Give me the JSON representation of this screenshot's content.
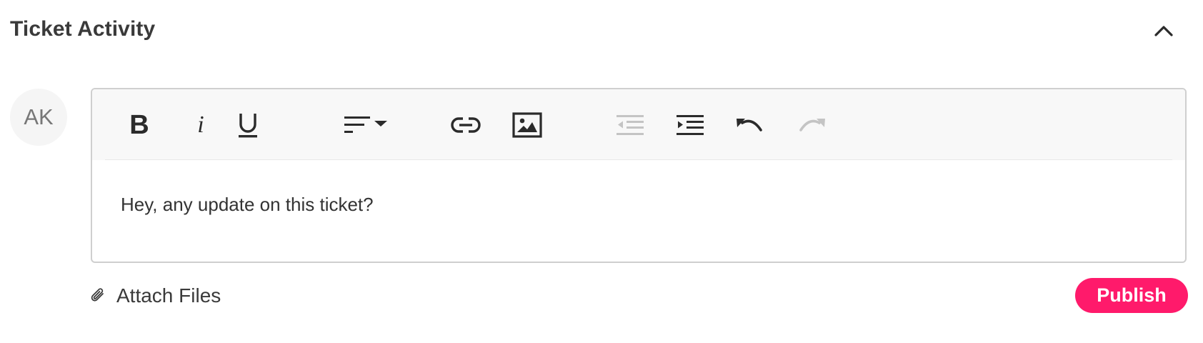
{
  "header": {
    "title": "Ticket Activity",
    "collapse_icon": "chevron-up-icon"
  },
  "avatar": {
    "initials": "AK"
  },
  "editor": {
    "toolbar": {
      "buttons": [
        {
          "name": "bold",
          "glyph": "B",
          "enabled": true
        },
        {
          "name": "italic",
          "glyph": "i",
          "enabled": true
        },
        {
          "name": "underline",
          "icon": "underline-icon",
          "enabled": true
        },
        {
          "name": "align",
          "icon": "align-left-dropdown-icon",
          "enabled": true
        },
        {
          "name": "link",
          "icon": "link-icon",
          "enabled": true
        },
        {
          "name": "image",
          "icon": "image-icon",
          "enabled": true
        },
        {
          "name": "outdent",
          "icon": "outdent-icon",
          "enabled": false
        },
        {
          "name": "indent",
          "icon": "indent-icon",
          "enabled": true
        },
        {
          "name": "undo",
          "icon": "undo-icon",
          "enabled": true
        },
        {
          "name": "redo",
          "icon": "redo-icon",
          "enabled": false
        }
      ]
    },
    "content": "Hey, any update on this ticket?"
  },
  "footer": {
    "attach_label": "Attach Files",
    "attach_icon": "paperclip-icon",
    "publish_label": "Publish"
  },
  "colors": {
    "accent": "#ff1a6b",
    "icon_active": "#2b2b2b",
    "icon_disabled": "#c4c4c4",
    "toolbar_bg": "#f8f8f8",
    "border": "#cfcfcf"
  }
}
